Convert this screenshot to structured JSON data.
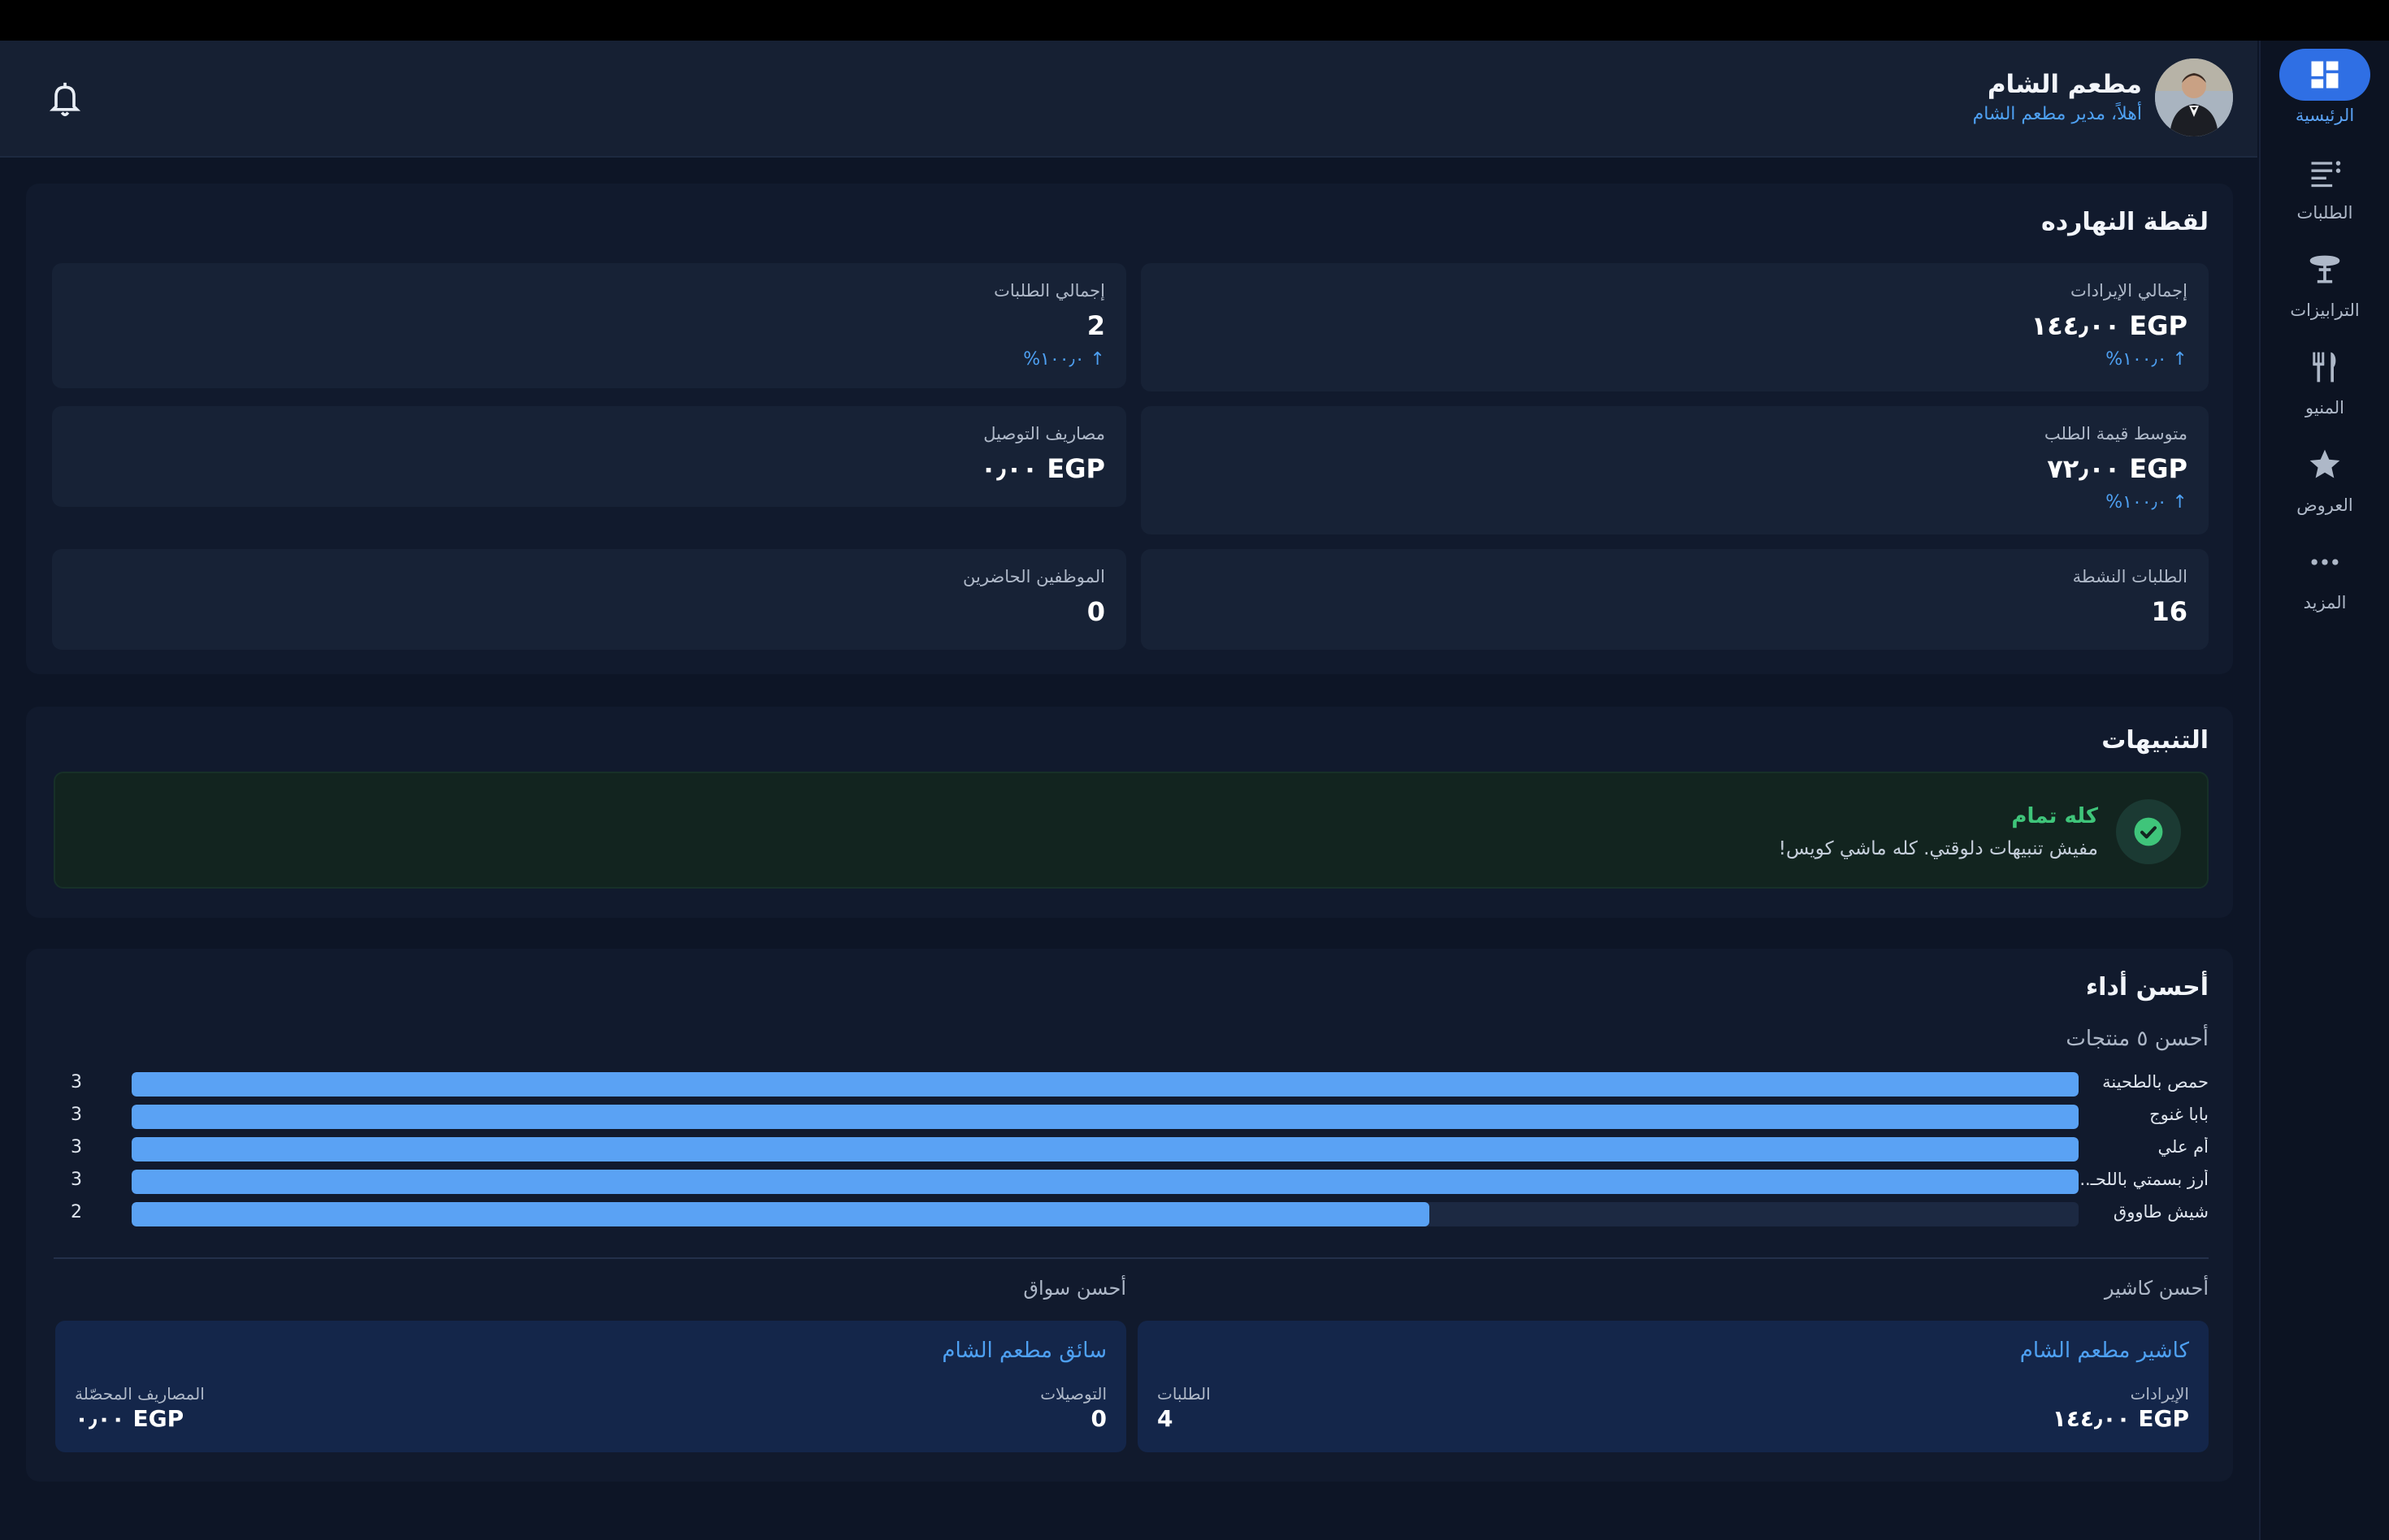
{
  "nav": {
    "items": [
      {
        "label": "الرئيسية",
        "icon": "dashboard-icon"
      },
      {
        "label": "الطلبات",
        "icon": "list-icon"
      },
      {
        "label": "الترابيزات",
        "icon": "table-icon"
      },
      {
        "label": "المنيو",
        "icon": "cutlery-icon"
      },
      {
        "label": "العروض",
        "icon": "star-icon"
      },
      {
        "label": "المزيد",
        "icon": "more-icon"
      }
    ]
  },
  "header": {
    "restaurant_name": "مطعم الشام",
    "welcome": "أهلاً، مدير مطعم الشام"
  },
  "snapshot": {
    "title": "لقطة النهارده",
    "revenue": {
      "label": "إجمالي الإيرادات",
      "value": "EGP ١٤٤٫٠٠",
      "delta": "↑ ١٠٠٫٠%"
    },
    "orders": {
      "label": "إجمالي الطلبات",
      "value": "2",
      "delta": "↑ ١٠٠٫٠%"
    },
    "avg_order": {
      "label": "متوسط قيمة الطلب",
      "value": "EGP ٧٢٫٠٠",
      "delta": "↑ ١٠٠٫٠%"
    },
    "delivery_fees": {
      "label": "مصاريف التوصيل",
      "value": "EGP ٠٫٠٠"
    },
    "active_orders": {
      "label": "الطلبات النشطة",
      "value": "16"
    },
    "staff_present": {
      "label": "الموظفين الحاضرين",
      "value": "0"
    }
  },
  "alerts": {
    "title": "التنبيهات",
    "status_title": "كله تمام",
    "status_message": "مفيش تنبيهات دلوقتي. كله ماشي كويس!"
  },
  "performance": {
    "title": "أحسن أداء",
    "top_products_title": "أحسن ٥ منتجات",
    "best_cashier_title": "أحسن كاشير",
    "best_driver_title": "أحسن سواق",
    "cashier": {
      "name": "كاشير مطعم الشام",
      "revenue_label": "الإيرادات",
      "revenue_value": "EGP ١٤٤٫٠٠",
      "orders_label": "الطلبات",
      "orders_value": "4"
    },
    "driver": {
      "name": "سائق مطعم الشام",
      "deliveries_label": "التوصيلات",
      "deliveries_value": "0",
      "fees_label": "المصاريف المحصّلة",
      "fees_value": "EGP ٠٫٠٠"
    }
  },
  "chart_data": {
    "type": "bar",
    "categories": [
      "حمص بالطحينة",
      "بابا غنوج",
      "أم علي",
      "أرز بسمتي باللحـ...",
      "شيش طاووق"
    ],
    "values": [
      3,
      3,
      3,
      3,
      2
    ],
    "xlim": [
      0,
      3
    ],
    "orientation": "horizontal"
  },
  "colors": {
    "accent": "#2f6fe4",
    "bar": "#5aa2f4",
    "success": "#3fc57a",
    "background": "#0d1526"
  }
}
